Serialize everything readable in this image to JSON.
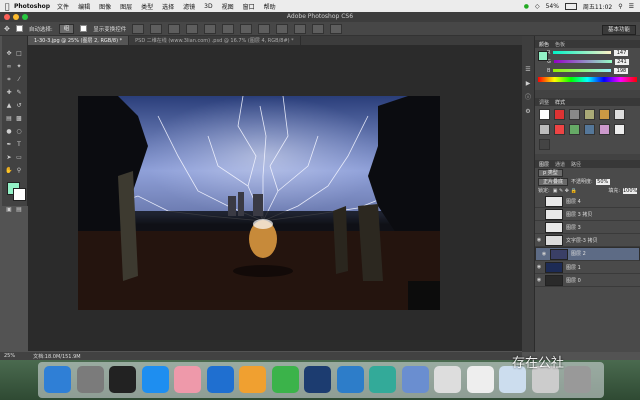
{
  "menubar": {
    "app": "Photoshop",
    "items": [
      "文件",
      "编辑",
      "图像",
      "图层",
      "类型",
      "选择",
      "滤镜",
      "3D",
      "视图",
      "窗口",
      "帮助"
    ],
    "battery": "54%",
    "clock": "周五11:02"
  },
  "window": {
    "title": "Adobe Photoshop CS6"
  },
  "options": {
    "auto_select_label": "自动选择:",
    "auto_select_value": "组",
    "show_transform_label": "显示变换控件",
    "workspace_label": "基本功能"
  },
  "tabs": [
    "1-30-3.jpg @ 25% (图层 2, RGB/8) *",
    "PSD 二维在线 (www.3lian.com) .psd @ 16.7% (图层 4, RGB/8#) *"
  ],
  "color_panel": {
    "tabs": [
      "颜色",
      "色板"
    ],
    "r": {
      "label": "R",
      "value": "147"
    },
    "g": {
      "label": "G",
      "value": "241"
    },
    "b": {
      "label": "B",
      "value": "198"
    },
    "fg_color": "#93f1c6"
  },
  "styles_panel": {
    "tabs": [
      "调整",
      "样式"
    ]
  },
  "layers_panel": {
    "tabs": [
      "图层",
      "通道",
      "路径"
    ],
    "filter_label": "p 类型",
    "blend_mode": "正片叠底",
    "opacity_label": "不透明度:",
    "opacity": "50%",
    "lock_label": "锁定:",
    "fill_label": "填充:",
    "fill": "100%",
    "layers": [
      {
        "name": "图层 4",
        "visible": false,
        "selected": false,
        "thumb": "#e8e8e8"
      },
      {
        "name": "图层 3 拷贝",
        "visible": false,
        "selected": false,
        "thumb": "#e8e8e8"
      },
      {
        "name": "图层 3",
        "visible": false,
        "selected": false,
        "thumb": "#e8e8e8"
      },
      {
        "name": "文字层-3 拷贝",
        "visible": true,
        "selected": false,
        "thumb": "#dcdcdc"
      },
      {
        "name": "图层 2",
        "visible": true,
        "selected": true,
        "thumb": "#3a3f66"
      },
      {
        "name": "图层 1",
        "visible": true,
        "selected": false,
        "thumb": "#1d2b55"
      },
      {
        "name": "图层 0",
        "visible": true,
        "selected": false,
        "thumb": "#2a2a2a"
      }
    ]
  },
  "status": {
    "zoom": "25%",
    "doc": "文档:18.0M/151.9M"
  },
  "dock": {
    "icons": [
      "Finder",
      "Launchpad",
      "QQ",
      "Safari",
      "Photos",
      "Keynote",
      "Pages",
      "iQIYI",
      "Ps",
      "Movies",
      "Mail",
      "Preview",
      "Files",
      "Doc",
      "Img",
      "Img2",
      "Trash"
    ]
  },
  "watermark": "存在公社"
}
